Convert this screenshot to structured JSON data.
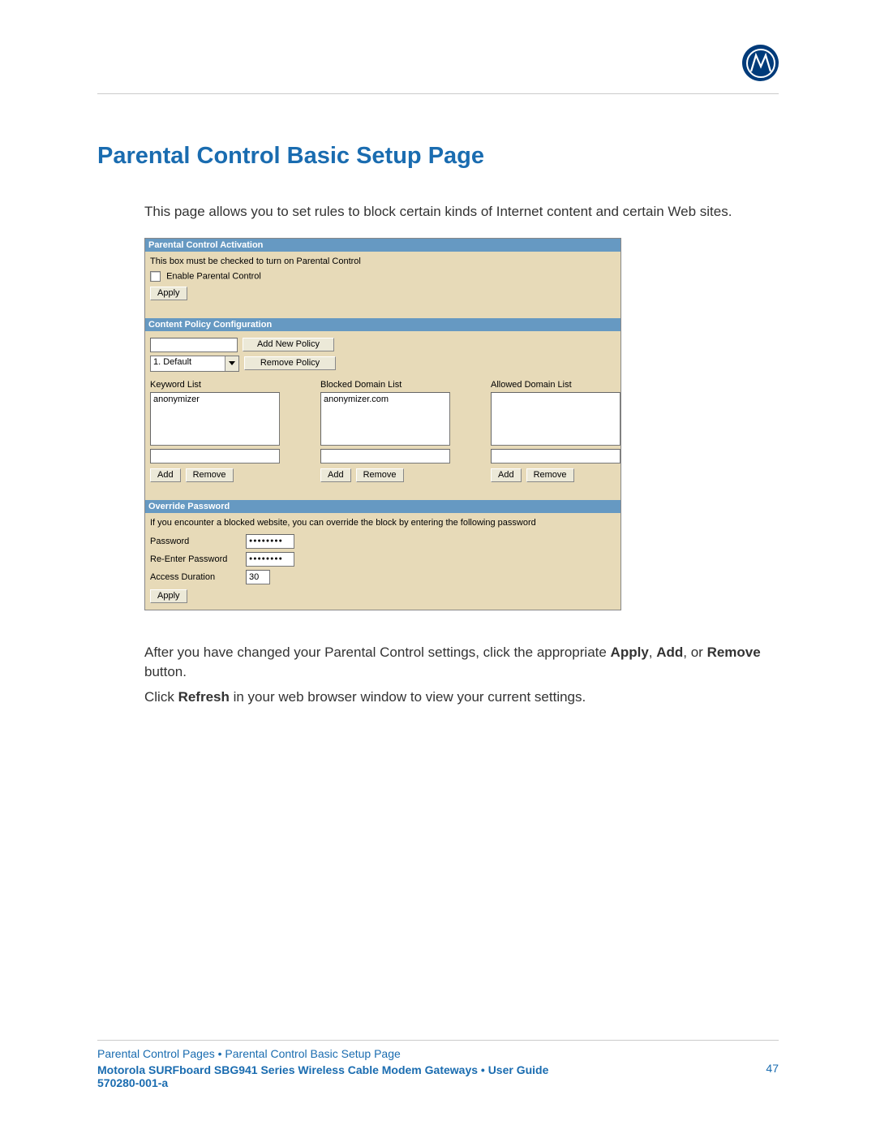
{
  "page_title": "Parental Control Basic Setup Page",
  "intro_text": "This page allows you to set rules to block certain kinds of Internet content and certain Web sites.",
  "activation": {
    "header": "Parental Control Activation",
    "note": "This box must be checked to turn on Parental Control",
    "checkbox_label": "Enable Parental Control",
    "apply_label": "Apply"
  },
  "policy": {
    "header": "Content Policy Configuration",
    "add_policy_label": "Add New Policy",
    "remove_policy_label": "Remove Policy",
    "selected_policy": "1. Default",
    "columns": {
      "keyword": {
        "label": "Keyword List",
        "value": "anonymizer",
        "add_label": "Add",
        "remove_label": "Remove"
      },
      "blocked": {
        "label": "Blocked Domain List",
        "value": "anonymizer.com",
        "add_label": "Add",
        "remove_label": "Remove"
      },
      "allowed": {
        "label": "Allowed Domain List",
        "value": "",
        "add_label": "Add",
        "remove_label": "Remove"
      }
    }
  },
  "override": {
    "header": "Override Password",
    "note": "If you encounter a blocked website, you can override the block by entering the following password",
    "password_label": "Password",
    "reenter_label": "Re-Enter Password",
    "duration_label": "Access Duration",
    "duration_value": "30",
    "password_mask": "●●●●●●●●",
    "apply_label": "Apply"
  },
  "after_para1_prefix": "After you have changed your Parental Control settings, click the appropriate ",
  "after_para1_b1": "Apply",
  "after_para1_mid1": ", ",
  "after_para1_b2": "Add",
  "after_para1_mid2": ", or ",
  "after_para1_b3": "Remove",
  "after_para1_suffix": " button.",
  "after_para2_prefix": "Click ",
  "after_para2_b1": "Refresh",
  "after_para2_suffix": " in your web browser window to view your current settings.",
  "footer": {
    "breadcrumb": "Parental Control Pages • Parental Control Basic Setup Page",
    "guide": "Motorola SURFboard SBG941 Series Wireless Cable Modem Gateways • User Guide",
    "doc_num": "570280-001-a",
    "page_num": "47"
  }
}
